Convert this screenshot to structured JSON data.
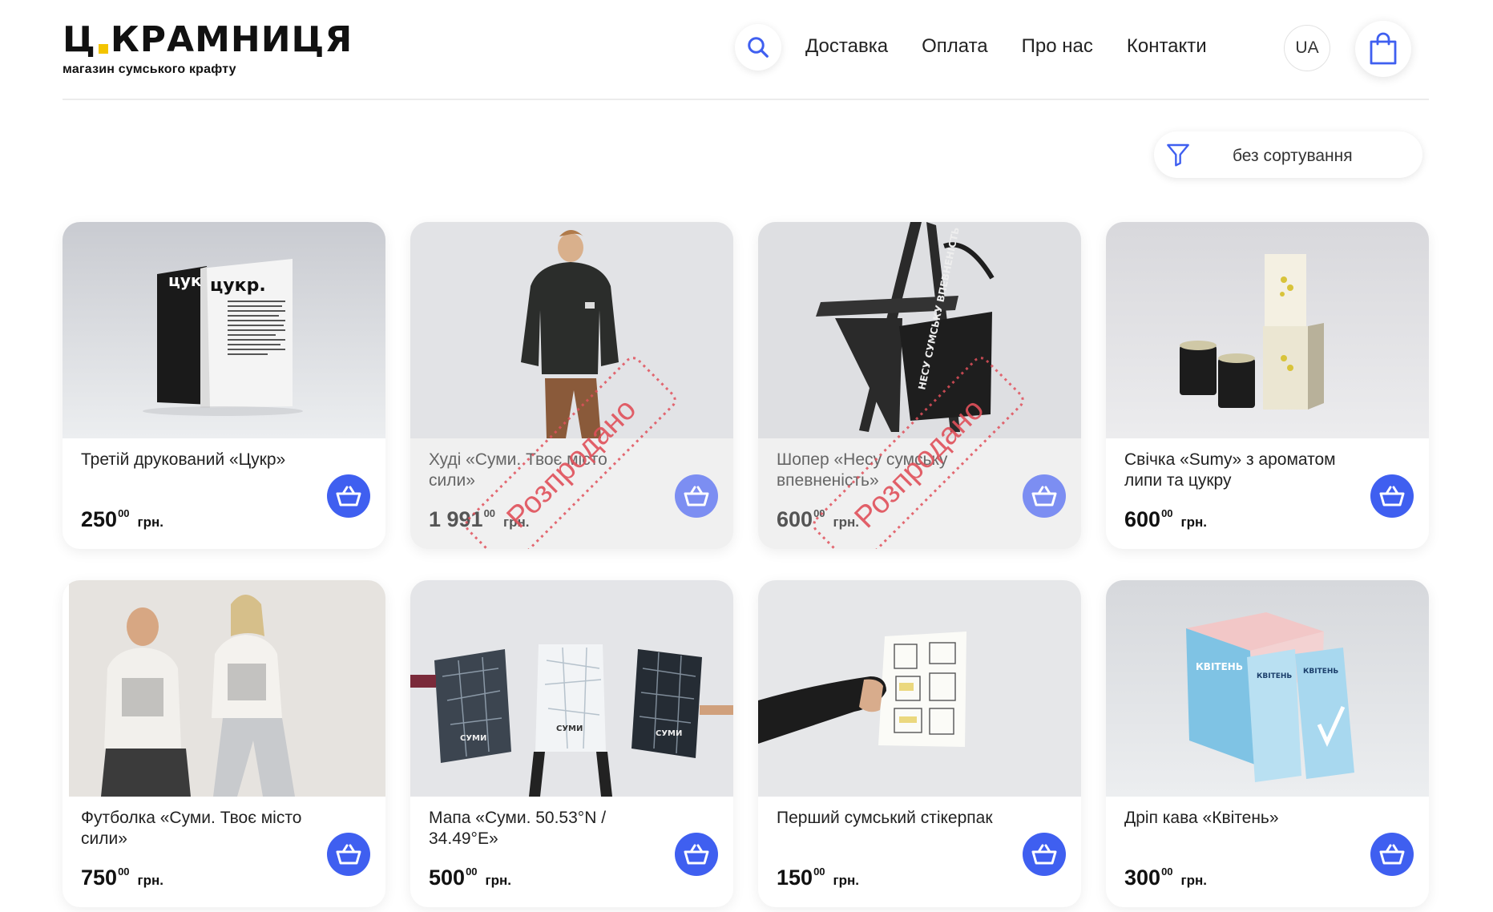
{
  "header": {
    "logo_main": "Ц.КРАМНИЦЯ",
    "logo_left": "Ц",
    "logo_right": "КРАМНИЦЯ",
    "logo_tagline": "магазин сумського крафту",
    "search_icon": "search-icon",
    "nav": [
      "Доставка",
      "Оплата",
      "Про нас",
      "Контакти"
    ],
    "lang": "UA",
    "cart_icon": "shopping-bag-icon"
  },
  "sort": {
    "icon": "filter-icon",
    "label": "без сортування"
  },
  "currency": "грн.",
  "colors": {
    "accent": "#3f5ff0",
    "stamp": "#e0505a",
    "logo_dot": "#f3c400"
  },
  "products": [
    {
      "title": "Третій друкований «Цукр»",
      "price_int": "250",
      "price_frac": "00",
      "sold": false,
      "image": "book-cukr-image"
    },
    {
      "title": "Худі «Суми. Твоє місто сили»",
      "price_int": "1 991",
      "price_frac": "00",
      "sold": true,
      "image": "hoodie-image"
    },
    {
      "title": "Шопер «Несу сумську впевненість»",
      "price_int": "600",
      "price_frac": "00",
      "sold": true,
      "image": "tote-bag-chair-image"
    },
    {
      "title": "Свічка «Sumy» з ароматом липи та цукру",
      "price_int": "600",
      "price_frac": "00",
      "sold": false,
      "image": "candles-image"
    },
    {
      "title": "Футболка «Суми. Твоє місто сили»",
      "price_int": "750",
      "price_frac": "00",
      "sold": false,
      "image": "tshirt-couple-image"
    },
    {
      "title": "Мапа «Суми. 50.53°N / 34.49°E»",
      "price_int": "500",
      "price_frac": "00",
      "sold": false,
      "image": "city-maps-image"
    },
    {
      "title": "Перший сумський стікерпак",
      "price_int": "150",
      "price_frac": "00",
      "sold": false,
      "image": "stickerpack-image"
    },
    {
      "title": "Дріп кава «Квітень»",
      "price_int": "300",
      "price_frac": "00",
      "sold": false,
      "image": "drip-coffee-image"
    }
  ],
  "sold_label": "Розпродано",
  "add_to_cart_icon": "basket-icon"
}
